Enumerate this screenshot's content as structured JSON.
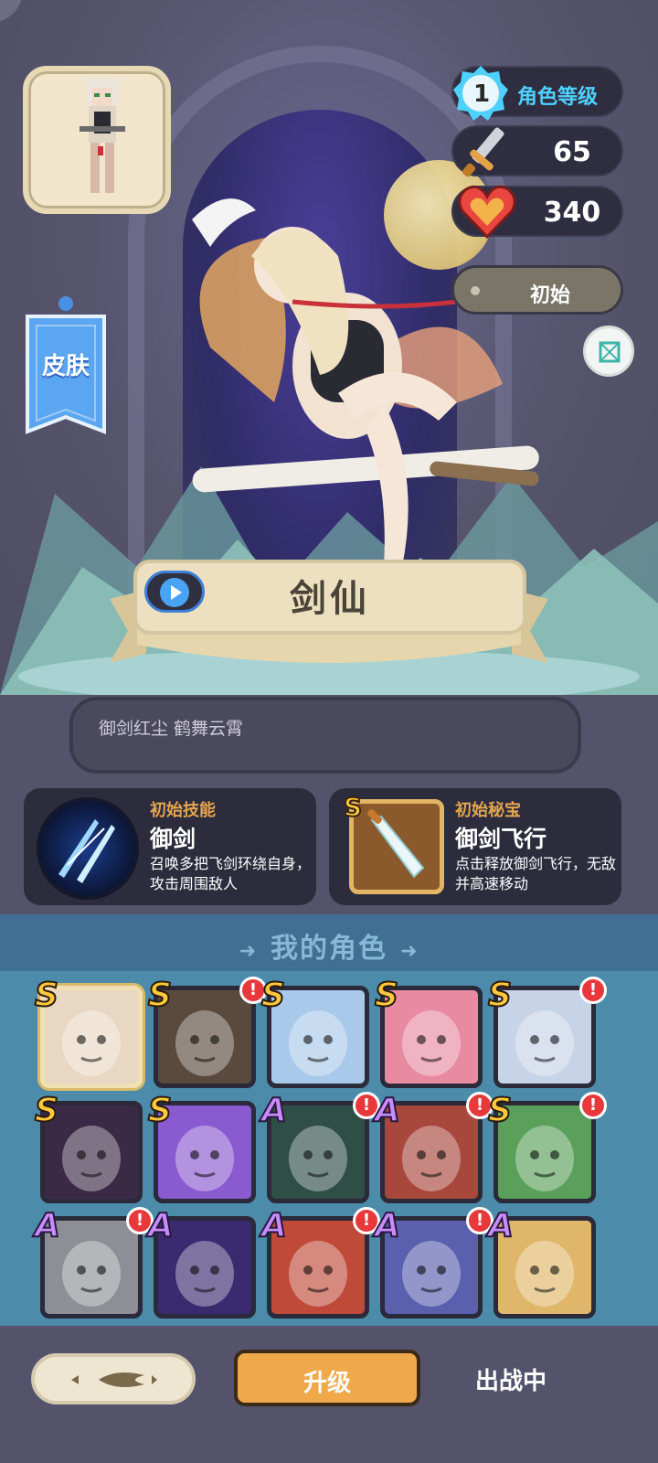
{
  "stats": {
    "level": "1",
    "level_label": "角色等级",
    "attack": "65",
    "hp": "340",
    "state": "初始"
  },
  "skin_button": "皮肤",
  "hero": {
    "name": "剑仙",
    "motto": "御剑红尘 鹤舞云霄"
  },
  "skill": {
    "title": "初始技能",
    "name": "御剑",
    "desc": "召唤多把飞剑环绕自身，攻击周围敌人"
  },
  "treasure": {
    "rank": "S",
    "title": "初始秘宝",
    "name": "御剑飞行",
    "desc": "点击释放御剑飞行，无敌并高速移动"
  },
  "section_title": "我的角色",
  "roster": [
    {
      "rank": "S",
      "alert": false,
      "selected": true,
      "color": "#e8d7c2"
    },
    {
      "rank": "S",
      "alert": true,
      "selected": false,
      "color": "#5a4a3e"
    },
    {
      "rank": "S",
      "alert": false,
      "selected": false,
      "color": "#a9c9ea"
    },
    {
      "rank": "S",
      "alert": false,
      "selected": false,
      "color": "#e98aa3"
    },
    {
      "rank": "S",
      "alert": true,
      "selected": false,
      "color": "#c7d3e6"
    },
    {
      "rank": "S",
      "alert": false,
      "selected": false,
      "color": "#3b2a45"
    },
    {
      "rank": "S",
      "alert": false,
      "selected": false,
      "color": "#8a5ad0"
    },
    {
      "rank": "A",
      "alert": true,
      "selected": false,
      "color": "#2f4e46"
    },
    {
      "rank": "A",
      "alert": true,
      "selected": false,
      "color": "#a8483c"
    },
    {
      "rank": "S",
      "alert": true,
      "selected": false,
      "color": "#5aa05a"
    },
    {
      "rank": "A",
      "alert": true,
      "selected": false,
      "color": "#8e8f96"
    },
    {
      "rank": "A",
      "alert": false,
      "selected": false,
      "color": "#3a2a70"
    },
    {
      "rank": "A",
      "alert": true,
      "selected": false,
      "color": "#c04a3a"
    },
    {
      "rank": "A",
      "alert": true,
      "selected": false,
      "color": "#5a5fae"
    },
    {
      "rank": "A",
      "alert": false,
      "selected": false,
      "color": "#e0b76a"
    }
  ],
  "buttons": {
    "upgrade": "升级",
    "deploy": "出战中"
  },
  "colors": {
    "accent": "#f0a94a",
    "level_text": "#4fd0ff",
    "section_bg": "#4c8ba9",
    "rank_s": "#ffc93a",
    "rank_a": "#c88cff",
    "alert": "#e8383b"
  }
}
